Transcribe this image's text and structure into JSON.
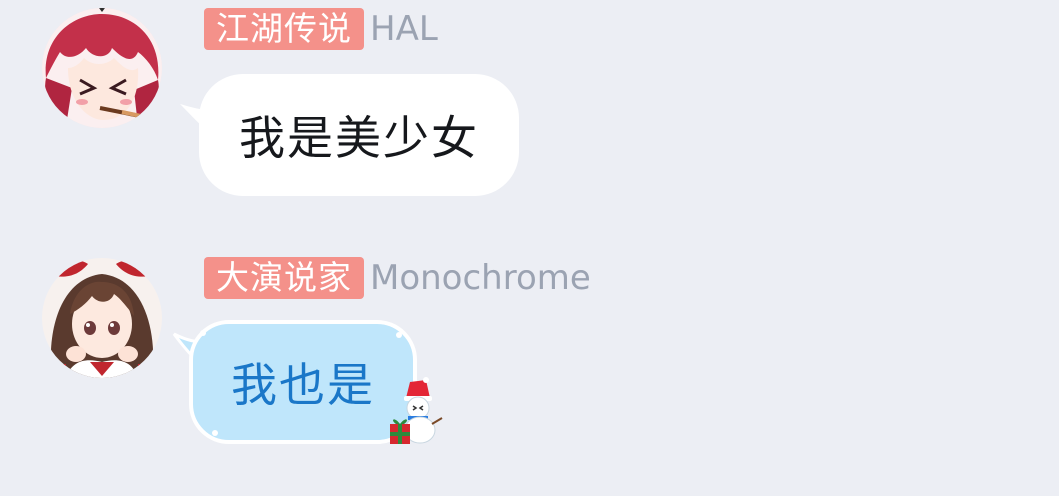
{
  "messages": [
    {
      "title": "江湖传说",
      "sender": "HAL",
      "text": "我是美少女",
      "avatar_icon": "red-hair-anime-girl-avatar",
      "bubble_style": "white"
    },
    {
      "title": "大演说家",
      "sender": "Monochrome",
      "text": "我也是",
      "avatar_icon": "shrine-maiden-anime-girl-avatar",
      "bubble_style": "blue-winter",
      "bubble_decoration": "snowman-with-gift-icon"
    }
  ],
  "colors": {
    "background": "#eceef4",
    "title_badge": "#f4918a",
    "nickname": "#9ba3b2",
    "bubble_blue": "#bfe6fb",
    "bubble_blue_text": "#1a77c8"
  }
}
